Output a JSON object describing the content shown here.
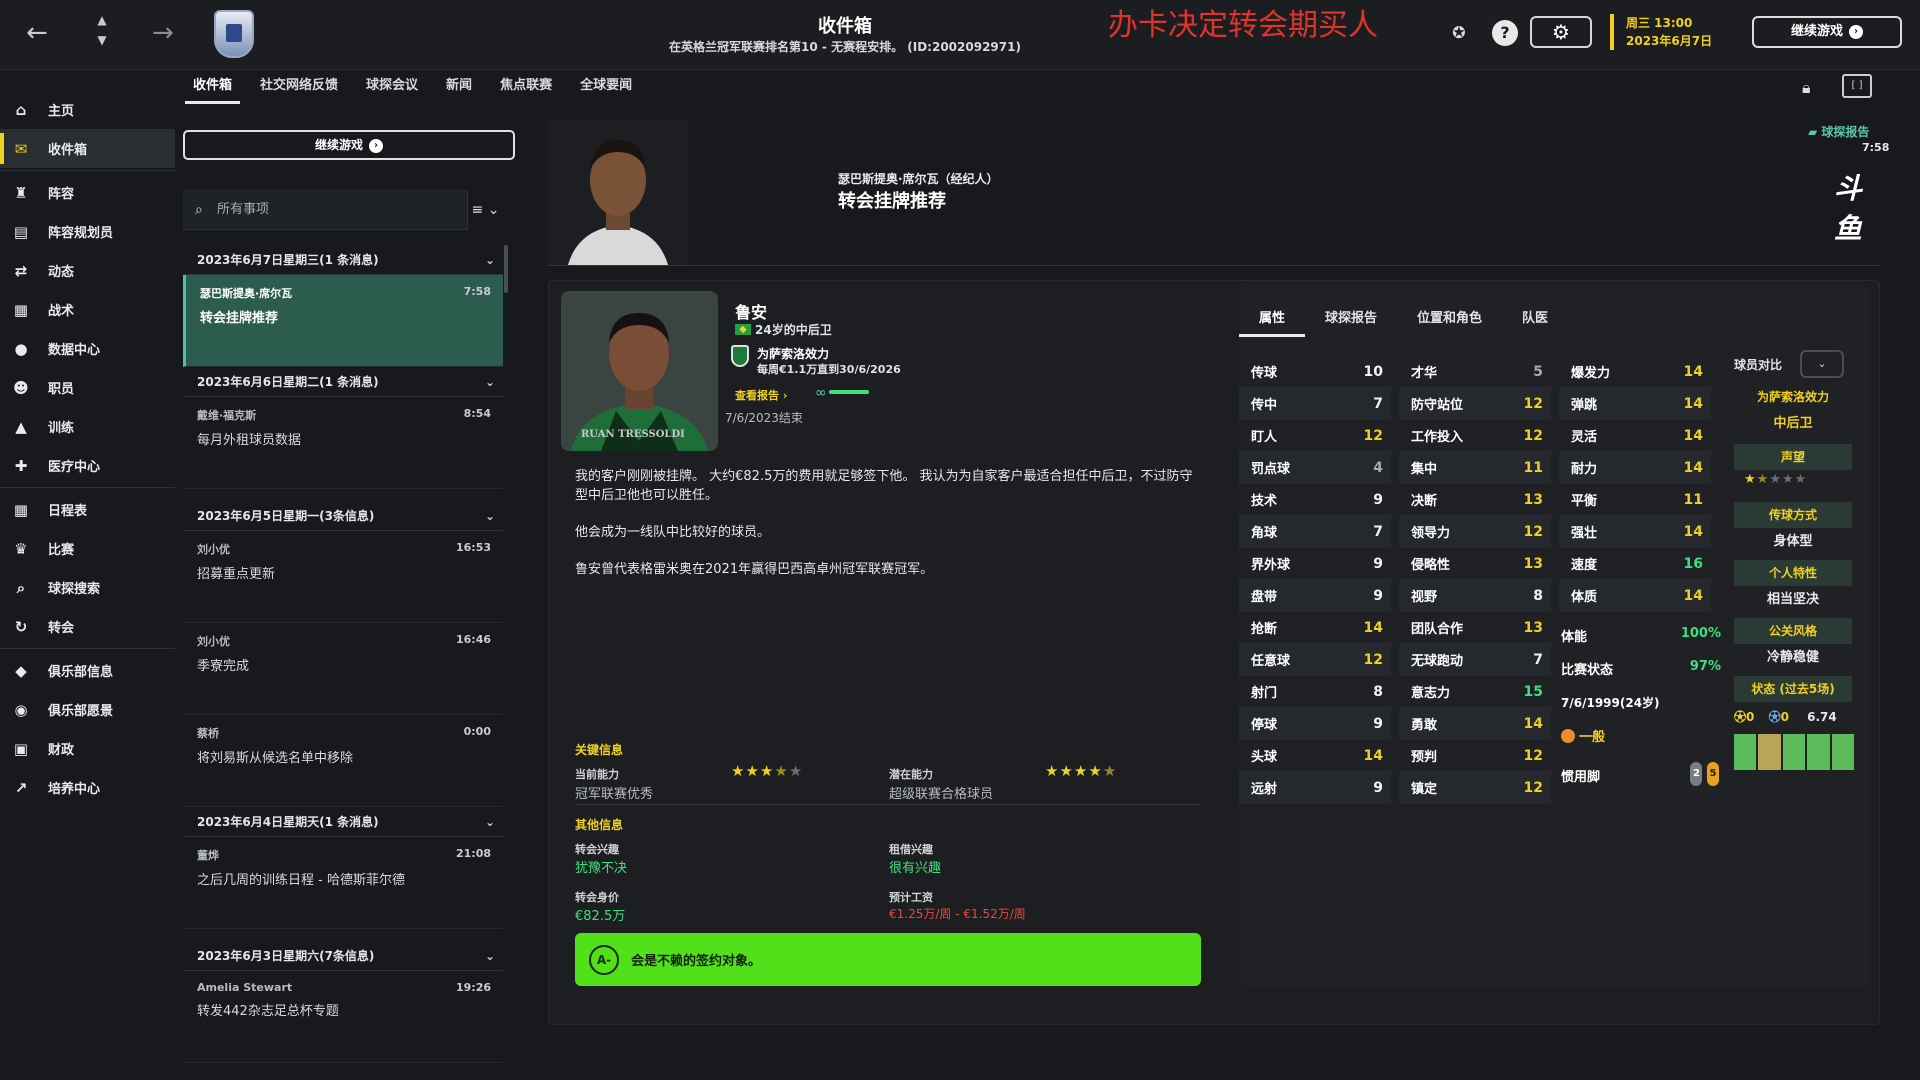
{
  "topbar": {
    "title": "收件箱",
    "subtitle": "在英格兰冠军联赛排名第10 - 无赛程安排。 (ID:2002092971)",
    "overlay": "办卡决定转会期买人",
    "help_glyph": "?",
    "settings_glyph": "⚙",
    "date_line1": "周三 13:00",
    "date_line2": "2023年6月7日",
    "continue_label": "继续游戏"
  },
  "sidebar": {
    "items": [
      {
        "label": "主页",
        "icon": "home-icon",
        "glyph": "⌂"
      },
      {
        "label": "收件箱",
        "icon": "inbox-icon",
        "glyph": "✉"
      },
      {
        "label": "阵容",
        "icon": "shirt-icon",
        "glyph": "♜"
      },
      {
        "label": "阵容规划员",
        "icon": "clipboard-icon",
        "glyph": "▤"
      },
      {
        "label": "动态",
        "icon": "dynamics-icon",
        "glyph": "⇄"
      },
      {
        "label": "战术",
        "icon": "tactics-icon",
        "glyph": "▦"
      },
      {
        "label": "数据中心",
        "icon": "data-icon",
        "glyph": "●"
      },
      {
        "label": "职员",
        "icon": "staff-icon",
        "glyph": "☻"
      },
      {
        "label": "训练",
        "icon": "training-icon",
        "glyph": "▲"
      },
      {
        "label": "医疗中心",
        "icon": "medical-icon",
        "glyph": "✚"
      },
      {
        "label": "日程表",
        "icon": "calendar-icon",
        "glyph": "▦"
      },
      {
        "label": "比赛",
        "icon": "trophy-icon",
        "glyph": "♛"
      },
      {
        "label": "球探搜索",
        "icon": "search-icon",
        "glyph": "⌕"
      },
      {
        "label": "转会",
        "icon": "transfer-icon",
        "glyph": "↻"
      },
      {
        "label": "俱乐部信息",
        "icon": "shield-icon",
        "glyph": "◆"
      },
      {
        "label": "俱乐部愿景",
        "icon": "vision-icon",
        "glyph": "◉"
      },
      {
        "label": "财政",
        "icon": "finance-icon",
        "glyph": "▣"
      },
      {
        "label": "培养中心",
        "icon": "development-icon",
        "glyph": "↗"
      }
    ]
  },
  "tabs": [
    "收件箱",
    "社交网络反馈",
    "球探会议",
    "新闻",
    "焦点联赛",
    "全球要闻"
  ],
  "inbox": {
    "continue_label": "继续游戏",
    "search_placeholder": "所有事项",
    "groups": [
      {
        "header": "2023年6月7日星期三(1 条消息)",
        "messages": [
          {
            "sender": "瑟巴斯提奥·席尔瓦",
            "subject": "转会挂牌推荐",
            "time": "7:58",
            "selected": true
          }
        ]
      },
      {
        "header": "2023年6月6日星期二(1 条消息)",
        "messages": [
          {
            "sender": "戴维·福克斯",
            "subject": "每月外租球员数据",
            "time": "8:54"
          }
        ]
      },
      {
        "header": "2023年6月5日星期一(3条信息)",
        "messages": [
          {
            "sender": "刘小优",
            "subject": "招募重点更新",
            "time": "16:53"
          },
          {
            "sender": "刘小优",
            "subject": "季寮完成",
            "time": "16:46"
          },
          {
            "sender": "蔡桥",
            "subject": "将刘易斯从候选名单中移除",
            "time": "0:00"
          }
        ]
      },
      {
        "header": "2023年6月4日星期天(1 条消息)",
        "messages": [
          {
            "sender": "董烨",
            "subject": "之后几周的训练日程 - 哈德斯菲尔德",
            "time": "21:08"
          }
        ]
      },
      {
        "header": "2023年6月3日星期六(7条信息)",
        "messages": [
          {
            "sender": "Amelia Stewart",
            "subject": "转发442杂志足总杯专题",
            "time": "19:26"
          }
        ]
      }
    ]
  },
  "message": {
    "from": "瑟巴斯提奥·席尔瓦（经纪人）",
    "title": "转会挂牌推荐",
    "report_tag": "球探报告",
    "report_time": "7:58",
    "logo_text": "斗鱼",
    "player": {
      "name": "鲁安",
      "age_position": "24岁的中后卫",
      "photo_caption": "RUAN TRESSOLDI",
      "club_line": "为萨索洛效力",
      "contract_line": "每周€1.1万直到30/6/2026",
      "view_report": "查看报告",
      "loan_glyph": "∞",
      "contract_end": "7/6/2023结束"
    },
    "paragraphs": [
      "我的客户刚刚被挂牌。 大约€82.5万的费用就足够签下他。 我认为为自家客户最适合担任中后卫，不过防守型中后卫他也可以胜任。",
      "他会成为一线队中比较好的球员。",
      "鲁安曾代表格雷米奥在2021年赢得巴西高卓州冠军联赛冠军。"
    ],
    "key_info": {
      "title": "关键信息",
      "ca_label": "当前能力",
      "ca_value": "冠军联赛优秀",
      "ca_stars": 3.5,
      "pa_label": "潜在能力",
      "pa_value": "超级联赛合格球员",
      "pa_stars": 4.5
    },
    "other_info": {
      "title": "其他信息",
      "transfer_interest_label": "转会兴趣",
      "transfer_interest_value": "犹豫不决",
      "loan_interest_label": "租借兴趣",
      "loan_interest_value": "很有兴趣",
      "value_label": "转会身价",
      "value_value": "€82.5万",
      "wage_label": "预计工资",
      "wage_value": "€1.25万/周 - €1.52万/周"
    },
    "verdict": {
      "grade": "A-",
      "text": "会是不赖的签约对象。"
    }
  },
  "attributes": {
    "tabs": [
      "属性",
      "球探报告",
      "位置和角色",
      "队医"
    ],
    "technical": [
      {
        "name": "传球",
        "value": 10
      },
      {
        "name": "传中",
        "value": 7
      },
      {
        "name": "盯人",
        "value": 12
      },
      {
        "name": "罚点球",
        "value": 4
      },
      {
        "name": "技术",
        "value": 9
      },
      {
        "name": "角球",
        "value": 7
      },
      {
        "name": "界外球",
        "value": 9
      },
      {
        "name": "盘带",
        "value": 9
      },
      {
        "name": "抢断",
        "value": 14
      },
      {
        "name": "任意球",
        "value": 12
      },
      {
        "name": "射门",
        "value": 8
      },
      {
        "name": "停球",
        "value": 9
      },
      {
        "name": "头球",
        "value": 14
      },
      {
        "name": "远射",
        "value": 9
      }
    ],
    "mental": [
      {
        "name": "才华",
        "value": 5
      },
      {
        "name": "防守站位",
        "value": 12
      },
      {
        "name": "工作投入",
        "value": 12
      },
      {
        "name": "集中",
        "value": 11
      },
      {
        "name": "决断",
        "value": 13
      },
      {
        "name": "领导力",
        "value": 12
      },
      {
        "name": "侵略性",
        "value": 13
      },
      {
        "name": "视野",
        "value": 8
      },
      {
        "name": "团队合作",
        "value": 13
      },
      {
        "name": "无球跑动",
        "value": 7
      },
      {
        "name": "意志力",
        "value": 15
      },
      {
        "name": "勇敢",
        "value": 14
      },
      {
        "name": "预判",
        "value": 12
      },
      {
        "name": "镇定",
        "value": 12
      }
    ],
    "physical": [
      {
        "name": "爆发力",
        "value": 14
      },
      {
        "name": "弹跳",
        "value": 14
      },
      {
        "name": "灵活",
        "value": 14
      },
      {
        "name": "耐力",
        "value": 14
      },
      {
        "name": "平衡",
        "value": 11
      },
      {
        "name": "强壮",
        "value": 14
      },
      {
        "name": "速度",
        "value": 16
      },
      {
        "name": "体质",
        "value": 14
      }
    ],
    "fitness_label": "体能",
    "fitness_value": "100%",
    "match_sharpness_label": "比赛状态",
    "match_sharpness_value": "97%",
    "dob": "7/6/1999(24岁)",
    "morale": "一般",
    "foot_label": "惯用脚",
    "left_foot": "2",
    "right_foot": "5",
    "compare_label": "球员对比",
    "side": {
      "club": "为萨索洛效力",
      "position": "中后卫",
      "reputation_label": "声望",
      "reputation_stars": 1.5,
      "play_style_label": "传球方式",
      "play_style_value": "身体型",
      "trait_label": "个人特性",
      "trait_value": "相当坚决",
      "media_label": "公关风格",
      "media_value": "冷静稳健",
      "form_label": "状态 (过去5场)",
      "goals": "0",
      "assists": "0",
      "rating": "6.74"
    }
  }
}
